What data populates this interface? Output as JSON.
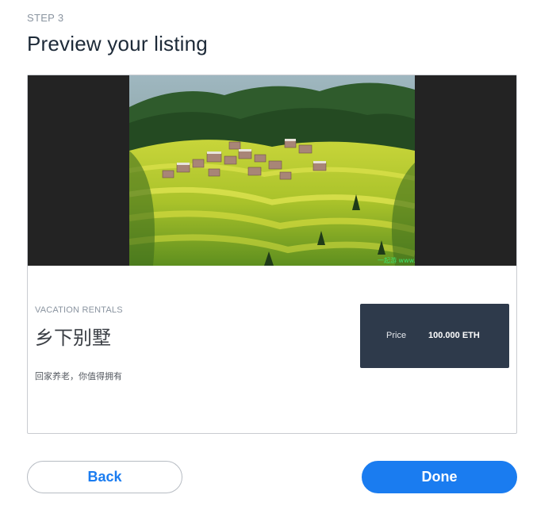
{
  "header": {
    "step_label": "STEP 3",
    "title": "Preview your listing"
  },
  "listing": {
    "photo_watermark": "一起游 www.",
    "category": "VACATION RENTALS",
    "title": "乡下别墅",
    "description": "回家养老，你值得拥有",
    "price_label": "Price",
    "price_value": "100.000 ETH"
  },
  "actions": {
    "back_label": "Back",
    "done_label": "Done"
  },
  "colors": {
    "accent": "#1a7cf0",
    "price_box": "#2e3a4b",
    "photo_letterbox": "#232323"
  }
}
